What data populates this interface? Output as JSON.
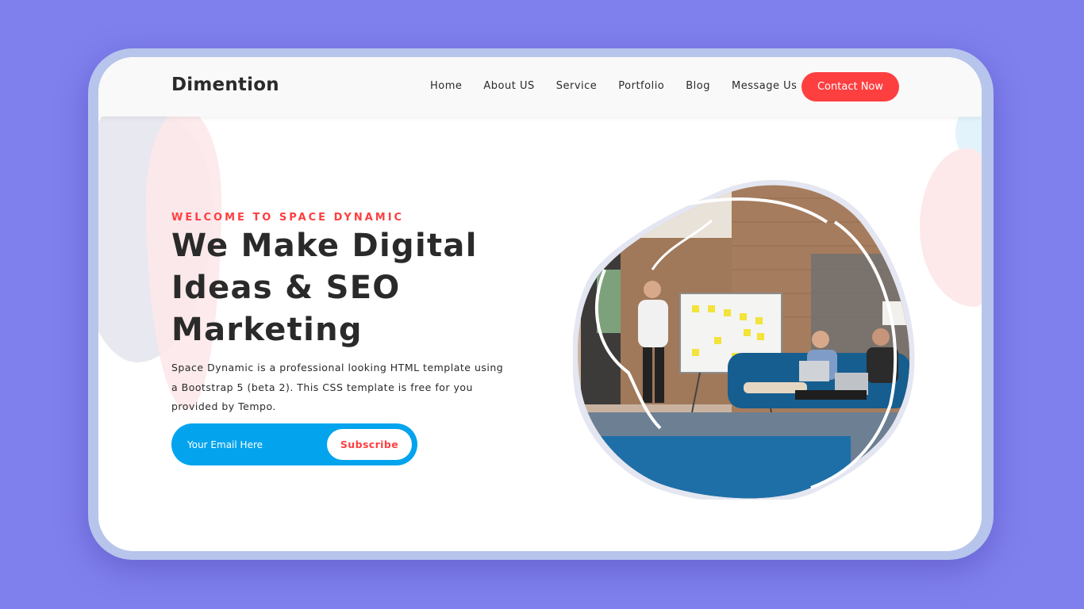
{
  "brand": {
    "logo_text": "Dimention"
  },
  "nav": {
    "items": [
      {
        "label": "Home"
      },
      {
        "label": "About US"
      },
      {
        "label": "Service"
      },
      {
        "label": "Portfolio"
      },
      {
        "label": "Blog"
      },
      {
        "label": "Message Us"
      }
    ],
    "cta_label": "Contact Now"
  },
  "hero": {
    "eyebrow": "WELCOME TO SPACE DYNAMIC",
    "headline": "We Make Digital Ideas & SEO Marketing",
    "description": "Space Dynamic is a professional looking HTML template using a Bootstrap 5 (beta 2). This CSS template is free for you provided by Tempo.",
    "subscribe": {
      "placeholder": "Your Email Here",
      "button_label": "Subscribe"
    },
    "image_icon": "team-meeting-photo"
  },
  "colors": {
    "background": "#7f7fee",
    "device_frame": "#b7c5ec",
    "accent_red": "#fe3f40",
    "accent_blue": "#03a4ed",
    "text_dark": "#2a2a2a"
  }
}
